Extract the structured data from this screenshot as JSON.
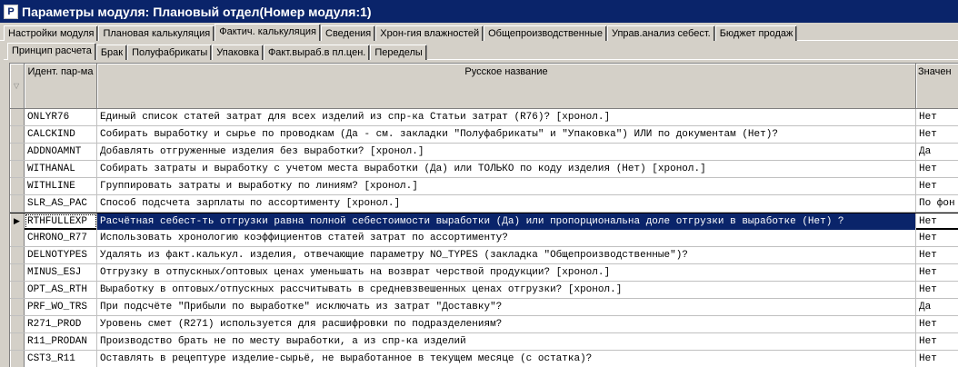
{
  "window": {
    "title": "Параметры модуля: Плановый отдел(Номер модуля:1)",
    "icon_letter": "P"
  },
  "tabs_top": [
    "Настройки модуля",
    "Плановая калькуляция",
    "Фактич. калькуляция",
    "Сведения",
    "Хрон-гия влажностей",
    "Общепроизводственные",
    "Управ.анализ себест.",
    "Бюджет продаж"
  ],
  "tabs_sub": [
    "Принцип расчета",
    "Брак",
    "Полуфабрикаты",
    "Упаковка",
    "Факт.выраб.в пл.цен.",
    "Переделы"
  ],
  "columns": {
    "id": "Идент. пар-ма",
    "name": "Русское название",
    "value": "Значен"
  },
  "rows": [
    {
      "id": "ONLYR76",
      "name": "Единый список статей затрат для всех изделий из спр-ка Статьи затрат (R76)? [хронол.]",
      "value": "Нет"
    },
    {
      "id": "CALCKIND",
      "name": "Собирать выработку и сырье по проводкам (Да - см. закладки \"Полуфабрикаты\" и \"Упаковка\") ИЛИ по документам (Нет)?",
      "value": "Нет"
    },
    {
      "id": "ADDNOAMNT",
      "name": "Добавлять отгруженные изделия без выработки? [хронол.]",
      "value": "Да"
    },
    {
      "id": "WITHANAL",
      "name": "Собирать затраты и выработку с учетом места выработки (Да) или ТОЛЬКО по коду изделия (Нет) [хронол.]",
      "value": "Нет"
    },
    {
      "id": "WITHLINE",
      "name": "Группировать затраты и выработку по линиям? [хронол.]",
      "value": "Нет"
    },
    {
      "id": "SLR_AS_PAC",
      "name": "Способ подсчета зарплаты по ассортименту [хронол.]",
      "value": "По фон"
    },
    {
      "id": "RTHFULLEXP",
      "name": "Расчётная себест-ть отгрузки равна полной себестоимости выработки (Да) или пропорциональна доле отгрузки в выработке (Нет) ?",
      "value": "Нет"
    },
    {
      "id": "CHRONO_R77",
      "name": "Использовать  хронологию  коэффициентов  статей затрат по ассортименту?",
      "value": "Нет"
    },
    {
      "id": "DELNOTYPES",
      "name": "Удалять из факт.калькул. изделия, отвечающие параметру NO_TYPES (закладка \"Общепроизводственные\")?",
      "value": "Нет"
    },
    {
      "id": "MINUS_ESJ",
      "name": "Отгрузку в отпускных/оптовых ценах уменьшать на возврат черствой продукции? [хронол.]",
      "value": "Нет"
    },
    {
      "id": "OPT_AS_RTH",
      "name": "Выработку в оптовых/отпускных рассчитывать в средневзвешенных ценах отгрузки? [хронол.]",
      "value": "Нет"
    },
    {
      "id": "PRF_WO_TRS",
      "name": "При подсчёте \"Прибыли по выработке\" исключать из затрат \"Доставку\"?",
      "value": "Да"
    },
    {
      "id": "R271_PROD",
      "name": "Уровень смет (R271) используется для расшифровки по подразделениям?",
      "value": "Нет"
    },
    {
      "id": "R11_PRODAN",
      "name": "Производство брать не по месту выработки, а из спр-ка изделий",
      "value": "Нет"
    },
    {
      "id": "CST3_R11",
      "name": "Оставлять в рецептуре изделие-сырьё, не выработанное в текущем месяце (с остатка)?",
      "value": "Нет"
    }
  ],
  "selected_row_index": 6
}
